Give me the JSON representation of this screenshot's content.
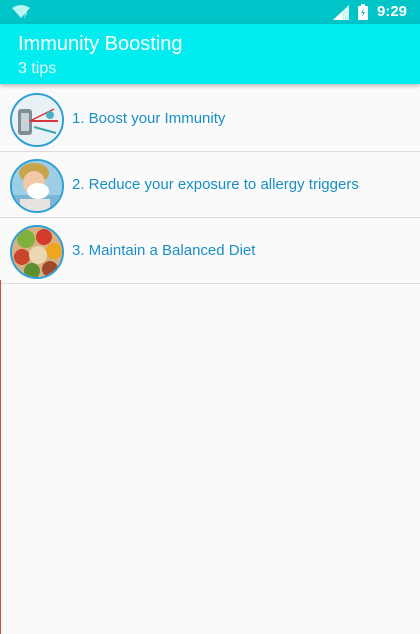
{
  "status_bar": {
    "time": "9:29",
    "icons": [
      "wifi-icon",
      "cell-signal-icon",
      "battery-icon"
    ]
  },
  "app_bar": {
    "title": "Immunity Boosting",
    "subtitle": "3 tips",
    "color": "#00ecef"
  },
  "tips": [
    {
      "label": "1. Boost your Immunity",
      "thumbnail": "immunity-illustration"
    },
    {
      "label": "2. Reduce your exposure to allergy triggers",
      "thumbnail": "child-blowing-nose-photo"
    },
    {
      "label": "3. Maintain a Balanced Diet",
      "thumbnail": "healthy-food-photo"
    }
  ],
  "colors": {
    "status_bar": "#00c4c7",
    "tip_text": "#1a8fc3",
    "thumb_border": "#2e9fd6"
  }
}
